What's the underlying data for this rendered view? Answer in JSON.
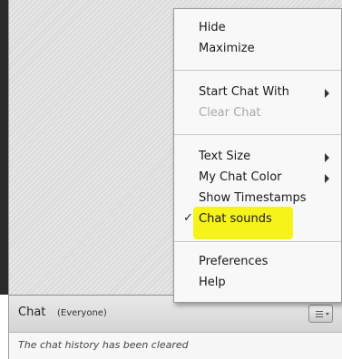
{
  "menu": {
    "items": {
      "hide": "Hide",
      "maximize": "Maximize",
      "start_chat_with": "Start Chat With",
      "clear_chat": "Clear Chat",
      "text_size": "Text Size",
      "my_chat_color": "My Chat Color",
      "show_timestamps": "Show Timestamps",
      "chat_sounds": "Chat sounds",
      "preferences": "Preferences",
      "help": "Help"
    },
    "checkmark": "✓",
    "highlight_color": "#f6f31a"
  },
  "chat": {
    "title": "Chat",
    "scope": "(Everyone)",
    "history_message": "The chat history has been cleared"
  },
  "icons": {
    "options": "menu-lines-icon",
    "submenu": "chevron-right-icon",
    "check": "checkmark-icon"
  }
}
